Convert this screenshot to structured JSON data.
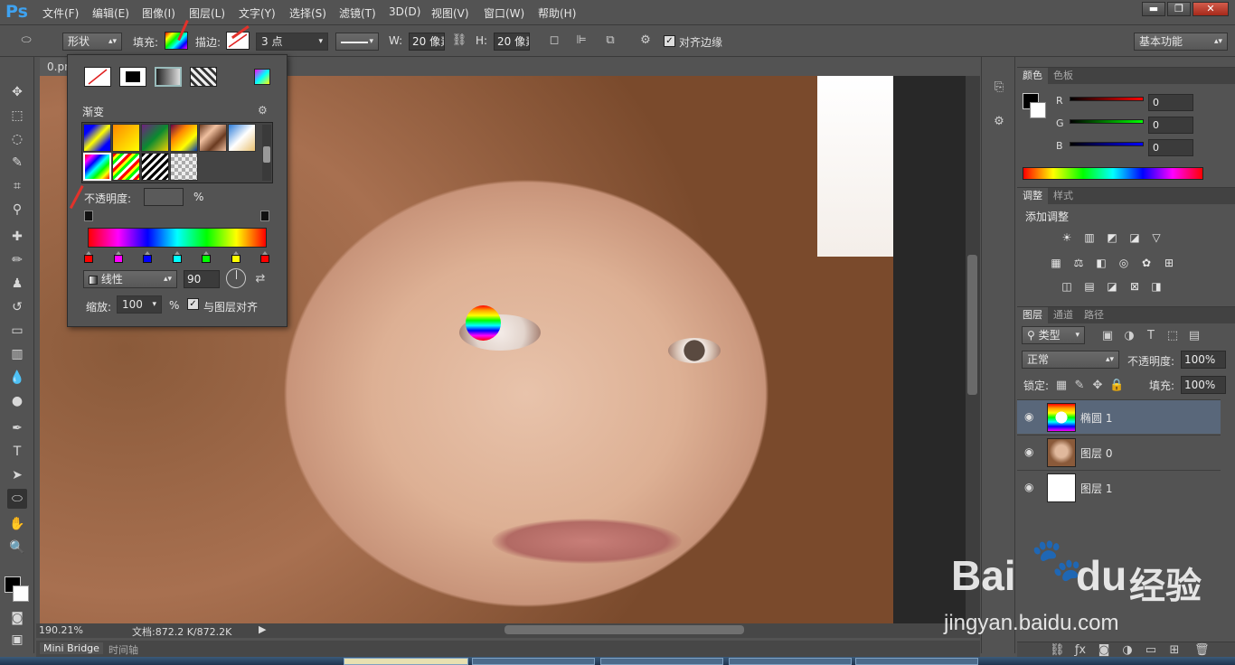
{
  "app": {
    "logo": "Ps"
  },
  "menubar": {
    "items": [
      "文件(F)",
      "编辑(E)",
      "图像(I)",
      "图层(L)",
      "文字(Y)",
      "选择(S)",
      "滤镜(T)",
      "3D(D)",
      "视图(V)",
      "窗口(W)",
      "帮助(H)"
    ]
  },
  "window_buttons": {
    "minimize": "▬",
    "restore": "❐",
    "close": "✕"
  },
  "options_bar": {
    "mode_value": "形状",
    "fill_label": "填充:",
    "stroke_label": "描边:",
    "stroke_size": "3 点",
    "w_label": "W:",
    "w_value": "20 像素",
    "h_label": "H:",
    "h_value": "20 像素",
    "align_edges_label": "对齐边缘",
    "workspace": "基本功能"
  },
  "document": {
    "tab": "0.pn",
    "zoom": "190.21%",
    "doc_info": "文档:872.2 K/872.2K"
  },
  "bottom_tabs": [
    "Mini Bridge",
    "时间轴"
  ],
  "gradient_popup": {
    "section_title": "渐变",
    "opacity_label": "不透明度:",
    "opacity_unit": "%",
    "style_value": "线性",
    "angle_value": "90",
    "scale_label": "缩放:",
    "scale_value": "100",
    "scale_unit": "%",
    "align_label": "与图层对齐",
    "stop_colors": [
      "#ff0000",
      "#ff00ff",
      "#0000ff",
      "#00ffff",
      "#00ff00",
      "#ffff00",
      "#ff0000"
    ]
  },
  "color_panel": {
    "tabs": [
      "颜色",
      "色板"
    ],
    "r_label": "R",
    "g_label": "G",
    "b_label": "B",
    "r_value": "0",
    "g_value": "0",
    "b_value": "0"
  },
  "adjust_panel": {
    "tabs": [
      "调整",
      "样式"
    ],
    "title": "添加调整"
  },
  "layers_panel": {
    "tabs": [
      "图层",
      "通道",
      "路径"
    ],
    "filter_value": "类型",
    "blend_value": "正常",
    "opacity_label": "不透明度:",
    "opacity_value": "100%",
    "lock_label": "锁定:",
    "fill_label": "填充:",
    "fill_value": "100%",
    "layers": [
      {
        "name": "椭圆 1",
        "selected": true
      },
      {
        "name": "图层 0",
        "selected": false
      },
      {
        "name": "图层 1",
        "selected": false
      }
    ]
  },
  "watermark": {
    "brand": "Bai",
    "brand2": "du",
    "cn": "经验",
    "url": "jingyan.baidu.com"
  },
  "colors": {
    "accent": "#3ea2f0",
    "selection": "#59677a",
    "arrow": "#e2322b"
  }
}
